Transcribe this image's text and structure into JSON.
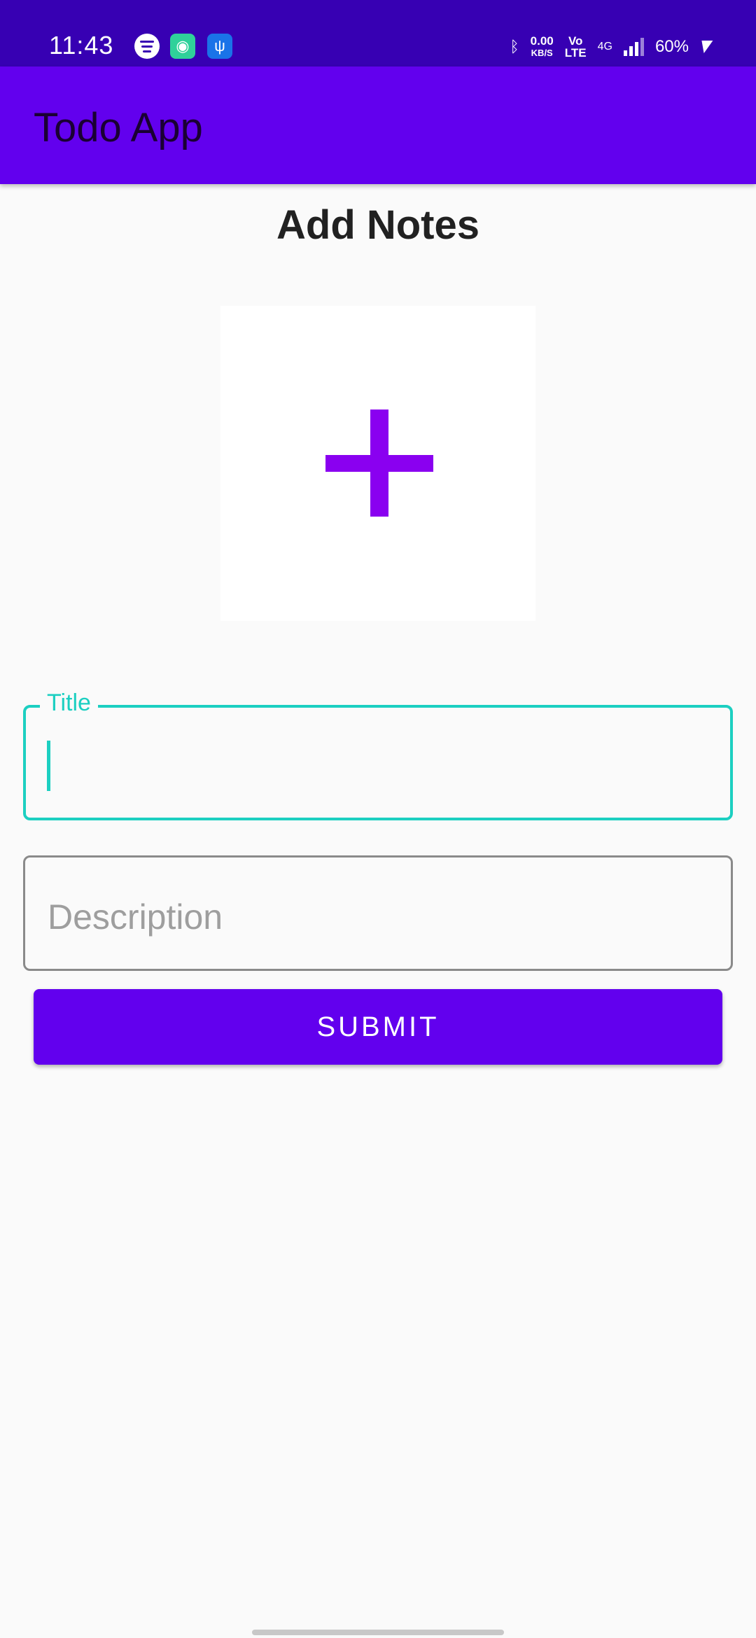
{
  "status_bar": {
    "time": "11:43",
    "net_speed_value": "0.00",
    "net_speed_unit": "KB/S",
    "volte_top": "Vo",
    "volte_bottom": "LTE",
    "network": "4G",
    "battery": "60%",
    "icons": [
      "spotify-icon",
      "green-app-icon",
      "usb-icon",
      "bluetooth-icon",
      "signal-icon",
      "charging-icon"
    ]
  },
  "app_bar": {
    "title": "Todo App"
  },
  "page": {
    "title": "Add Notes"
  },
  "image_picker": {
    "icon": "plus-icon"
  },
  "form": {
    "title_label": "Title",
    "title_value": "",
    "description_placeholder": "Description",
    "description_value": "",
    "submit_label": "SUBMIT"
  },
  "colors": {
    "status_bar": "#3700b3",
    "app_bar": "#6200ee",
    "accent": "#1ccfc1",
    "plus": "#8a00f0"
  }
}
